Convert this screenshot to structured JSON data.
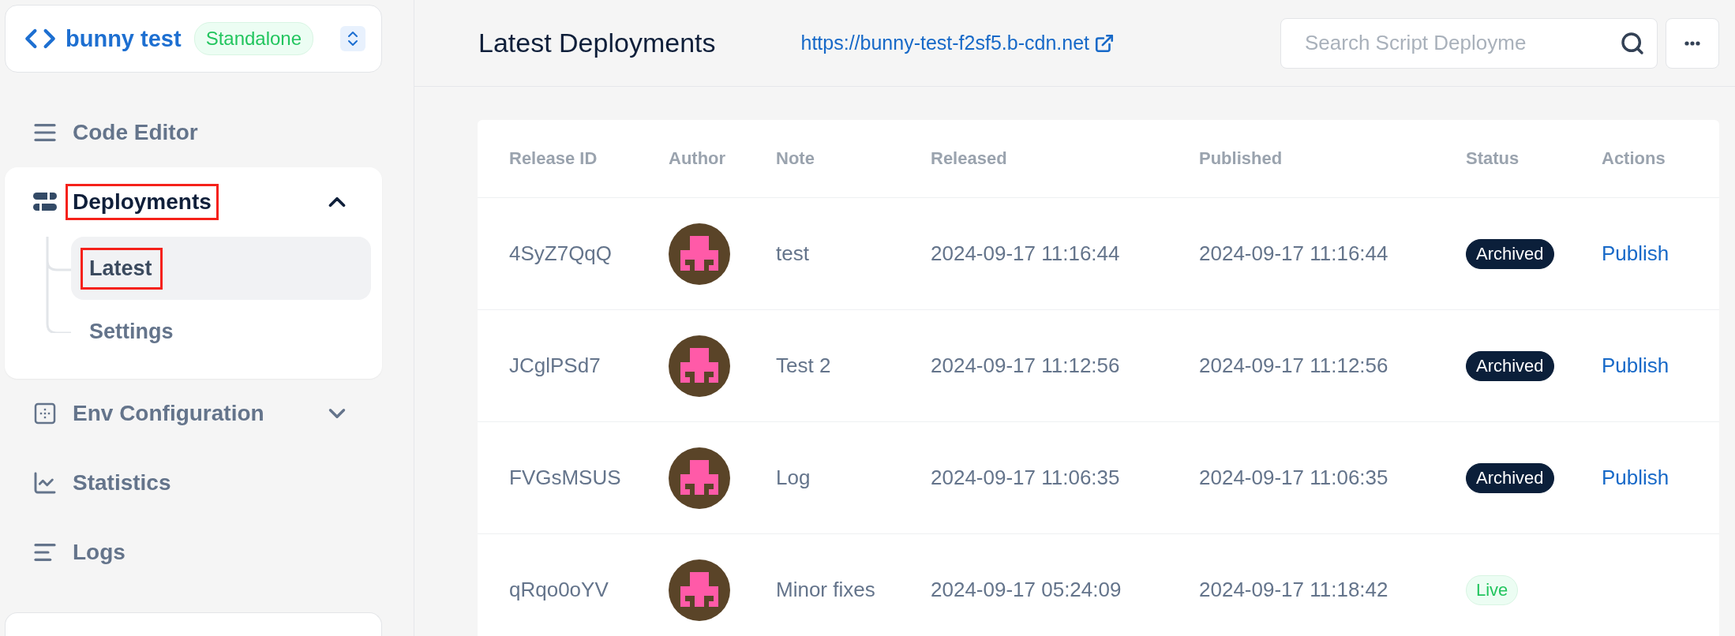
{
  "project": {
    "name": "bunny test",
    "badge": "Standalone"
  },
  "nav": [
    {
      "kind": "link",
      "label": "Code Editor",
      "highlighted": false
    },
    {
      "kind": "group",
      "label": "Deployments",
      "expanded": true,
      "highlighted": true,
      "children": [
        {
          "label": "Latest",
          "selected": true,
          "highlighted": true
        },
        {
          "label": "Settings",
          "selected": false,
          "highlighted": false
        }
      ]
    },
    {
      "kind": "group",
      "label": "Env Configuration",
      "expanded": false,
      "highlighted": false
    },
    {
      "kind": "link",
      "label": "Statistics",
      "highlighted": false
    },
    {
      "kind": "link",
      "label": "Logs",
      "highlighted": false
    }
  ],
  "header": {
    "title": "Latest Deployments",
    "url": "https://bunny-test-f2sf5.b-cdn.net",
    "search": {
      "placeholder": "Search Script Deployme"
    }
  },
  "table": {
    "columns": [
      "Release ID",
      "Author",
      "Note",
      "Released",
      "Published",
      "Status",
      "Actions"
    ],
    "rows": [
      {
        "id": "4SyZ7QqQ",
        "note": "test",
        "released": "2024-09-17 11:16:44",
        "published": "2024-09-17 11:16:44",
        "status": {
          "kind": "archived",
          "label": "Archived"
        },
        "action": "Publish"
      },
      {
        "id": "JCglPSd7",
        "note": "Test 2",
        "released": "2024-09-17 11:12:56",
        "published": "2024-09-17 11:12:56",
        "status": {
          "kind": "archived",
          "label": "Archived"
        },
        "action": "Publish"
      },
      {
        "id": "FVGsMSUS",
        "note": "Log",
        "released": "2024-09-17 11:06:35",
        "published": "2024-09-17 11:06:35",
        "status": {
          "kind": "archived",
          "label": "Archived"
        },
        "action": "Publish"
      },
      {
        "id": "qRqo0oYV",
        "note": "Minor fixes",
        "released": "2024-09-17 05:24:09",
        "published": "2024-09-17 11:18:42",
        "status": {
          "kind": "live",
          "label": "Live"
        }
      }
    ]
  }
}
